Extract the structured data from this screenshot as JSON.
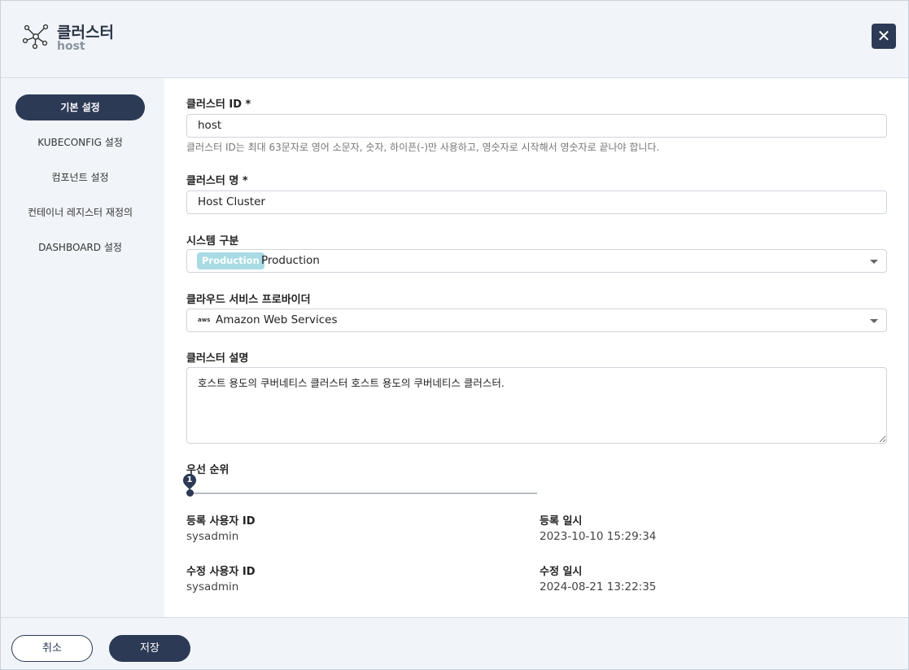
{
  "header": {
    "title": "클러스터",
    "subtitle": "host",
    "close_label": "✕",
    "icon": "cluster-network-icon"
  },
  "sidebar": {
    "items": [
      {
        "label": "기본 설정",
        "active": true
      },
      {
        "label": "KUBECONFIG 설정",
        "active": false
      },
      {
        "label": "컴포넌트 설정",
        "active": false
      },
      {
        "label": "컨테이너 레지스터 재정의",
        "active": false
      },
      {
        "label": "DASHBOARD 설정",
        "active": false
      }
    ]
  },
  "form": {
    "cluster_id": {
      "label": "클러스터 ID *",
      "value": "host",
      "help": "클러스터 ID는 최대 63문자로 영어 소문자, 숫자, 하이픈(-)만 사용하고, 영숫자로 시작해서 영숫자로 끝나야 합니다."
    },
    "cluster_name": {
      "label": "클러스터 명 *",
      "value": "Host Cluster"
    },
    "system_type": {
      "label": "시스템 구분",
      "badge": "Production",
      "value": "Production",
      "badge_color": "#a8dbe4"
    },
    "provider": {
      "label": "클라우드 서비스 프로바이더",
      "icon_text": "aws",
      "value": "Amazon Web Services"
    },
    "description": {
      "label": "클러스터 설명",
      "value": "호스트 용도의 쿠버네티스 클러스터 호스트 용도의 쿠버네티스 클러스터."
    },
    "priority": {
      "label": "우선 순위",
      "value": "1"
    }
  },
  "meta": {
    "created_by_label": "등록 사용자 ID",
    "created_by": "sysadmin",
    "created_at_label": "등록 일시",
    "created_at": "2023-10-10 15:29:34",
    "updated_by_label": "수정 사용자 ID",
    "updated_by": "sysadmin",
    "updated_at_label": "수정 일시",
    "updated_at": "2024-08-21 13:22:35"
  },
  "footer": {
    "cancel_label": "취소",
    "save_label": "저장"
  },
  "colors": {
    "primary": "#2c3a55",
    "panel_bg": "#f1f5f9"
  }
}
